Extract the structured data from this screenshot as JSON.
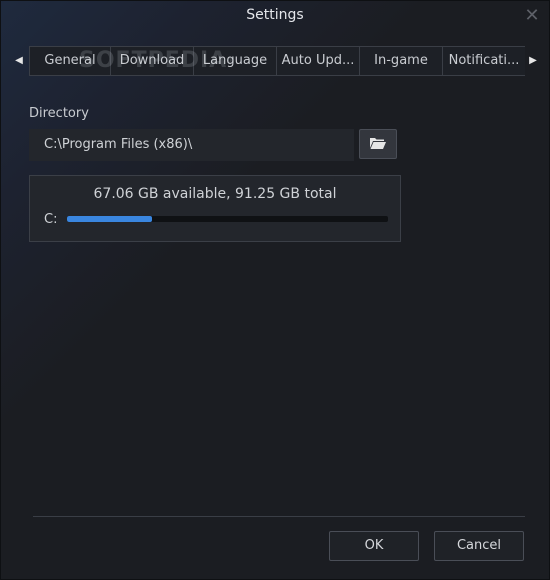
{
  "window": {
    "title": "Settings",
    "close_glyph": "✕"
  },
  "tabs": {
    "left_arrow": "◀",
    "right_arrow": "▶",
    "items": [
      {
        "label": "General",
        "width": 82
      },
      {
        "label": "Download",
        "width": 84
      },
      {
        "label": "Language",
        "width": 84
      },
      {
        "label": "Auto Upd...",
        "width": 84
      },
      {
        "label": "In-game",
        "width": 84
      },
      {
        "label": "Notificati...",
        "width": 84
      }
    ]
  },
  "watermark": {
    "text": "SOFTPEDIA",
    "mark": "®"
  },
  "directory": {
    "label": "Directory",
    "value": "C:\\Program Files (x86)\\",
    "browse_icon": "folder-open-icon"
  },
  "disk": {
    "summary": "67.06 GB available, 91.25 GB total",
    "drive": "C:",
    "used_fraction": 0.265
  },
  "footer": {
    "ok_label": "OK",
    "cancel_label": "Cancel"
  },
  "colors": {
    "accent": "#3a86e0",
    "background": "#1b1d22"
  }
}
